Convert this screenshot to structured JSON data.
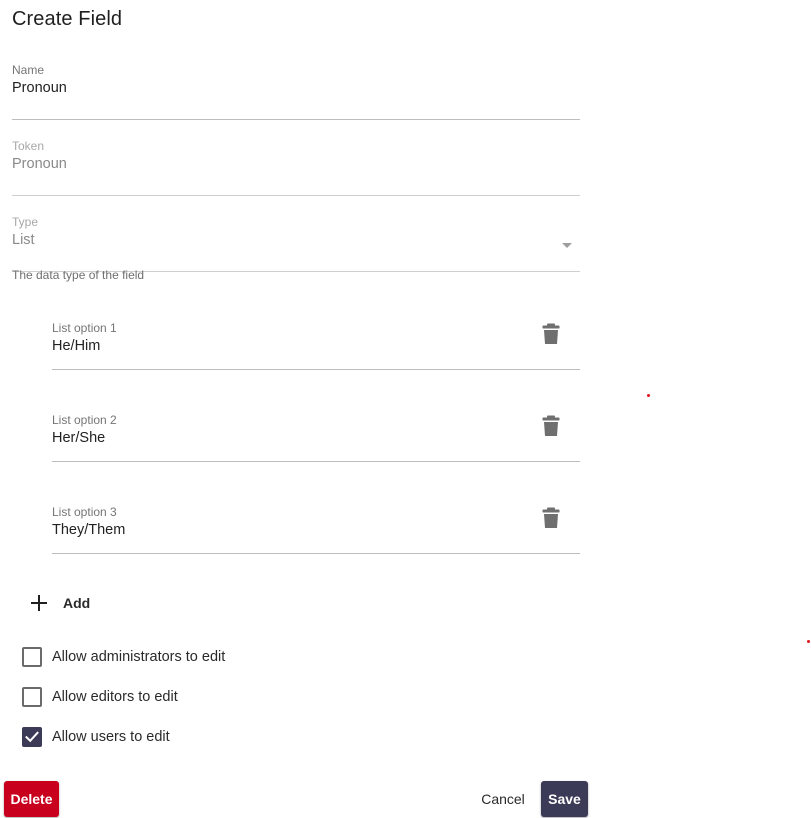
{
  "dialog": {
    "title": "Create Field"
  },
  "fields": {
    "name": {
      "label": "Name",
      "value": "Pronoun"
    },
    "token": {
      "label": "Token",
      "value": "Pronoun"
    },
    "type": {
      "label": "Type",
      "value": "List",
      "helper": "The data type of the field",
      "dropdown_icon": "caret-down-icon"
    }
  },
  "list_options": [
    {
      "label": "List option 1",
      "value": "He/Him",
      "icon": "trash-icon"
    },
    {
      "label": "List option 2",
      "value": "Her/She",
      "icon": "trash-icon"
    },
    {
      "label": "List option 3",
      "value": "They/Them",
      "icon": "trash-icon"
    }
  ],
  "add_button": {
    "label": "Add",
    "icon": "plus-icon"
  },
  "permissions": [
    {
      "label": "Allow administrators to edit",
      "checked": false
    },
    {
      "label": "Allow editors to edit",
      "checked": false
    },
    {
      "label": "Allow users to edit",
      "checked": true
    }
  ],
  "actions": {
    "delete_label": "Delete",
    "cancel_label": "Cancel",
    "save_label": "Save"
  },
  "colors": {
    "primary": "#3b3a57",
    "danger": "#c8001e",
    "divider": "#bdbdbd"
  }
}
